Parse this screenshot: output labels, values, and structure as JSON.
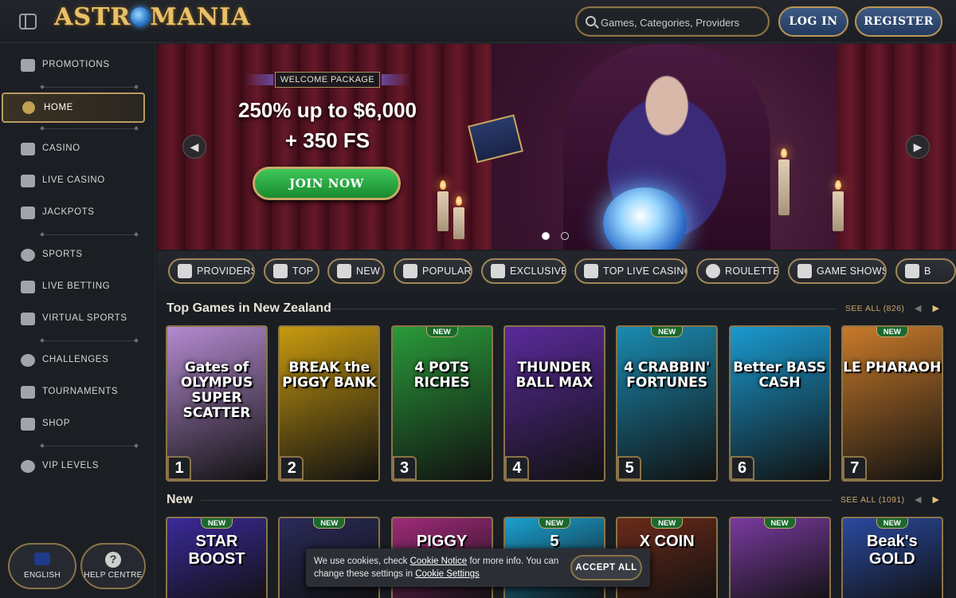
{
  "header": {
    "logo": "ASTROMANIA",
    "search_placeholder": "Games, Categories, Providers",
    "login_label": "LOG IN",
    "register_label": "REGISTER"
  },
  "sidebar": {
    "items": [
      {
        "label": "PROMOTIONS",
        "icon": "gift-icon"
      },
      {
        "label": "HOME",
        "icon": "home-icon",
        "active": true
      },
      {
        "label": "CASINO",
        "icon": "slot-machine-icon"
      },
      {
        "label": "LIVE CASINO",
        "icon": "cards-icon"
      },
      {
        "label": "JACKPOTS",
        "icon": "clover-icon"
      },
      {
        "label": "SPORTS",
        "icon": "soccer-ball-icon"
      },
      {
        "label": "LIVE BETTING",
        "icon": "live-icon"
      },
      {
        "label": "VIRTUAL SPORTS",
        "icon": "virtual-sports-icon"
      },
      {
        "label": "CHALLENGES",
        "icon": "target-icon"
      },
      {
        "label": "TOURNAMENTS",
        "icon": "podium-icon"
      },
      {
        "label": "SHOP",
        "icon": "shop-icon"
      },
      {
        "label": "VIP LEVELS",
        "icon": "vip-icon"
      }
    ],
    "language_label": "ENGLISH",
    "help_label": "HELP CENTRE",
    "help_glyph": "?"
  },
  "hero": {
    "badge": "WELCOME PACKAGE",
    "offer_line1": "250% up to $6,000",
    "offer_line2": "+ 350 FS",
    "cta": "JOIN NOW",
    "prev_glyph": "◀",
    "next_glyph": "▶",
    "slides": 2,
    "active_slide": 1
  },
  "categories": [
    {
      "label": "PROVIDERS",
      "icon": "providers-icon"
    },
    {
      "label": "TOP",
      "icon": "trophy-icon"
    },
    {
      "label": "NEW",
      "icon": "lightning-icon"
    },
    {
      "label": "POPULAR",
      "icon": "fire-icon"
    },
    {
      "label": "EXCLUSIVE",
      "icon": "diamond-icon"
    },
    {
      "label": "TOP LIVE CASINO",
      "icon": "crown-icon"
    },
    {
      "label": "ROULETTE",
      "icon": "roulette-icon"
    },
    {
      "label": "GAME SHOWS",
      "icon": "game-show-icon"
    },
    {
      "label": "B",
      "icon": "more-icon"
    }
  ],
  "top_games": {
    "title": "Top Games in New Zealand",
    "see_all": "SEE ALL (826)",
    "prev_glyph": "◀",
    "next_glyph": "▶",
    "games": [
      {
        "title": "Gates of OLYMPUS SUPER SCATTER",
        "rank": "1",
        "new": false,
        "color": "#b48ad0"
      },
      {
        "title": "BREAK the PIGGY BANK",
        "rank": "2",
        "new": false,
        "color": "#c89a10"
      },
      {
        "title": "4 POTS RICHES",
        "rank": "3",
        "new": true,
        "new_label": "NEW",
        "color": "#2a9a3a"
      },
      {
        "title": "THUNDER BALL MAX",
        "rank": "4",
        "new": false,
        "color": "#5a2a9a"
      },
      {
        "title": "4 CRABBIN' FORTUNES",
        "rank": "5",
        "new": true,
        "new_label": "NEW",
        "color": "#1a8ab0"
      },
      {
        "title": "Better BASS CASH",
        "rank": "6",
        "new": false,
        "color": "#1a9ad0"
      },
      {
        "title": "LE PHARAOH",
        "rank": "7",
        "new": true,
        "new_label": "NEW",
        "color": "#c87a2a"
      }
    ]
  },
  "new_games": {
    "title": "New",
    "see_all": "SEE ALL (1091)",
    "prev_glyph": "◀",
    "next_glyph": "▶",
    "games": [
      {
        "title": "STAR BOOST",
        "new": true,
        "new_label": "NEW",
        "color": "#3a2a9a"
      },
      {
        "title": "",
        "new": true,
        "new_label": "NEW",
        "color": "#2a2a5a"
      },
      {
        "title": "PIGGY",
        "new": false,
        "color": "#a02a7a"
      },
      {
        "title": "5",
        "new": true,
        "new_label": "NEW",
        "color": "#1aa0d0"
      },
      {
        "title": "X COIN",
        "new": true,
        "new_label": "NEW",
        "color": "#6a2a1a"
      },
      {
        "title": "",
        "new": true,
        "new_label": "NEW",
        "color": "#7a3aa0"
      },
      {
        "title": "Beak's GOLD",
        "new": true,
        "new_label": "NEW",
        "color": "#2a4aa0"
      }
    ]
  },
  "cookie": {
    "text_part1": "We use cookies, check ",
    "link1": "Cookie Notice",
    "text_part2": " for more info. You can change these settings in ",
    "link2": "Cookie Settings",
    "accept": "ACCEPT ALL"
  }
}
